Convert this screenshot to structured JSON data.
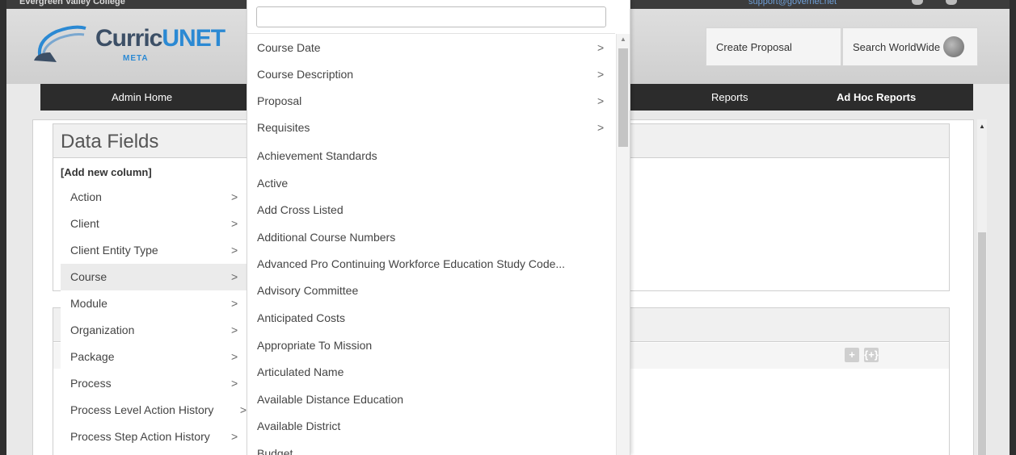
{
  "topbar": {
    "college": "Evergreen Valley College",
    "support": "support@governet.net"
  },
  "header": {
    "logo_brand_a": "Curric",
    "logo_brand_b": "UNET",
    "logo_sub": "META",
    "create_proposal": "Create Proposal",
    "search_worldwide": "Search WorldWide"
  },
  "nav": {
    "admin_home": "Admin Home",
    "reports": "Reports",
    "adhoc": "Ad Hoc Reports"
  },
  "datafields": {
    "title": "Data Fields",
    "add_column": "[Add new column]"
  },
  "left_menu": [
    {
      "label": "Action",
      "chev": ">"
    },
    {
      "label": "Client",
      "chev": ">"
    },
    {
      "label": "Client Entity Type",
      "chev": ">"
    },
    {
      "label": "Course",
      "chev": ">"
    },
    {
      "label": "Module",
      "chev": ">"
    },
    {
      "label": "Organization",
      "chev": ">"
    },
    {
      "label": "Package",
      "chev": ">"
    },
    {
      "label": "Process",
      "chev": ">"
    },
    {
      "label": "Process Level Action History",
      "chev": ">"
    },
    {
      "label": "Process Step Action History",
      "chev": ">"
    }
  ],
  "dropdown": {
    "search_value": "",
    "options": [
      {
        "label": "Course Date",
        "chev": ">"
      },
      {
        "label": "Course Description",
        "chev": ">"
      },
      {
        "label": "Proposal",
        "chev": ">"
      },
      {
        "label": "Requisites",
        "chev": ">"
      },
      {
        "label": "Achievement Standards",
        "chev": ""
      },
      {
        "label": "Active",
        "chev": ""
      },
      {
        "label": "Add Cross Listed",
        "chev": ""
      },
      {
        "label": "Additional Course Numbers",
        "chev": ""
      },
      {
        "label": "Advanced Pro Continuing Workforce Education Study Code...",
        "chev": ""
      },
      {
        "label": "Advisory Committee",
        "chev": ""
      },
      {
        "label": "Anticipated Costs",
        "chev": ""
      },
      {
        "label": "Appropriate To Mission",
        "chev": ""
      },
      {
        "label": "Articulated Name",
        "chev": ""
      },
      {
        "label": "Available Distance Education",
        "chev": ""
      },
      {
        "label": "Available District",
        "chev": ""
      },
      {
        "label": "Budget",
        "chev": ""
      }
    ]
  },
  "icons": {
    "scroll_up": "▲",
    "plus": "+",
    "expr": "{+}"
  }
}
